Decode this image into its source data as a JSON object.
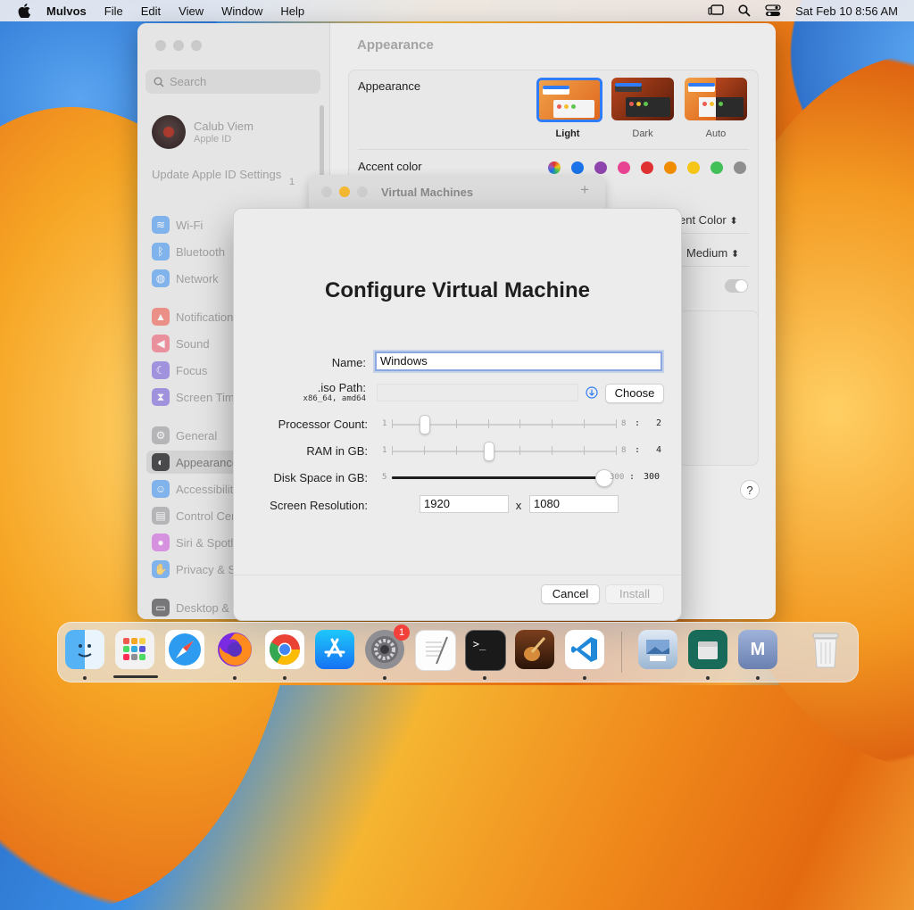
{
  "menubar": {
    "app_name": "Mulvos",
    "items": [
      "File",
      "Edit",
      "View",
      "Window",
      "Help"
    ],
    "datetime": "Sat Feb 10  8:56 AM"
  },
  "settings": {
    "search_placeholder": "Search",
    "profile_name": "Calub Viem",
    "profile_sub": "Apple ID",
    "update_text": "Update Apple ID Settings",
    "update_badge": "1",
    "sidebar_items": [
      {
        "label": "Wi-Fi",
        "icon": "wifi-icon",
        "color": "#2e8cf0"
      },
      {
        "label": "Bluetooth",
        "icon": "bluetooth-icon",
        "color": "#2e8cf0"
      },
      {
        "label": "Network",
        "icon": "globe-icon",
        "color": "#2e8cf0"
      },
      {
        "label": "Notifications",
        "icon": "bell-icon",
        "color": "#ee4c3b"
      },
      {
        "label": "Sound",
        "icon": "speaker-icon",
        "color": "#ee4c60"
      },
      {
        "label": "Focus",
        "icon": "moon-icon",
        "color": "#6a4fd8"
      },
      {
        "label": "Screen Time",
        "icon": "hourglass-icon",
        "color": "#6a4fd8"
      },
      {
        "label": "General",
        "icon": "gear-icon",
        "color": "#8e8e93"
      },
      {
        "label": "Appearance",
        "icon": "appearance-icon",
        "color": "#1c1c1e"
      },
      {
        "label": "Accessibility",
        "icon": "accessibility-icon",
        "color": "#2e8cf0"
      },
      {
        "label": "Control Centre",
        "icon": "control-centre-icon",
        "color": "#8e8e93"
      },
      {
        "label": "Siri & Spotlight",
        "icon": "siri-icon",
        "color": "#c94fd8"
      },
      {
        "label": "Privacy & Security",
        "icon": "hand-icon",
        "color": "#2e8cf0"
      },
      {
        "label": "Desktop & Dock",
        "icon": "dock-icon",
        "color": "#1c1c1e"
      }
    ],
    "content_title": "Appearance",
    "appearance_label": "Appearance",
    "appearance_options": [
      "Light",
      "Dark",
      "Auto"
    ],
    "accent_label": "Accent color",
    "accent_colors": [
      "#9b59b6",
      "#1a73e8",
      "#8e44ad",
      "#e84393",
      "#e03131",
      "#f08c00",
      "#f5c518",
      "#40c057",
      "#8e8e8e"
    ],
    "highlight_value": "ent Color",
    "sidebar_size_value": "Medium"
  },
  "vm_window": {
    "title": "Virtual Machines",
    "add_label": "+"
  },
  "dialog": {
    "title": "Configure Virtual Machine",
    "name_label": "Name:",
    "name_value": "Windows",
    "iso_label": ".iso Path:",
    "iso_sub": "x86_64, amd64",
    "choose_label": "Choose",
    "processor_label": "Processor Count:",
    "processor": {
      "min": "1",
      "max": "8",
      "value": "2",
      "fraction": 0.143
    },
    "ram_label": "RAM in GB:",
    "ram": {
      "min": "1",
      "max": "8",
      "value": "4",
      "fraction": 0.429
    },
    "disk_label": "Disk Space in GB:",
    "disk": {
      "min": "5",
      "max": "300",
      "value": "300",
      "fraction": 1.0
    },
    "colon": ":",
    "resolution_label": "Screen Resolution:",
    "res_width": "1920",
    "res_x": "x",
    "res_height": "1080",
    "cancel_label": "Cancel",
    "install_label": "Install"
  },
  "dock": {
    "apps": [
      "Finder",
      "Launchpad",
      "Safari",
      "Firefox",
      "Chrome",
      "App Store",
      "System Settings",
      "TextEdit",
      "Terminal",
      "Instruments",
      "VS Code",
      "Preview",
      "Archive",
      "Mulvos",
      "Trash"
    ],
    "settings_badge": "1"
  }
}
